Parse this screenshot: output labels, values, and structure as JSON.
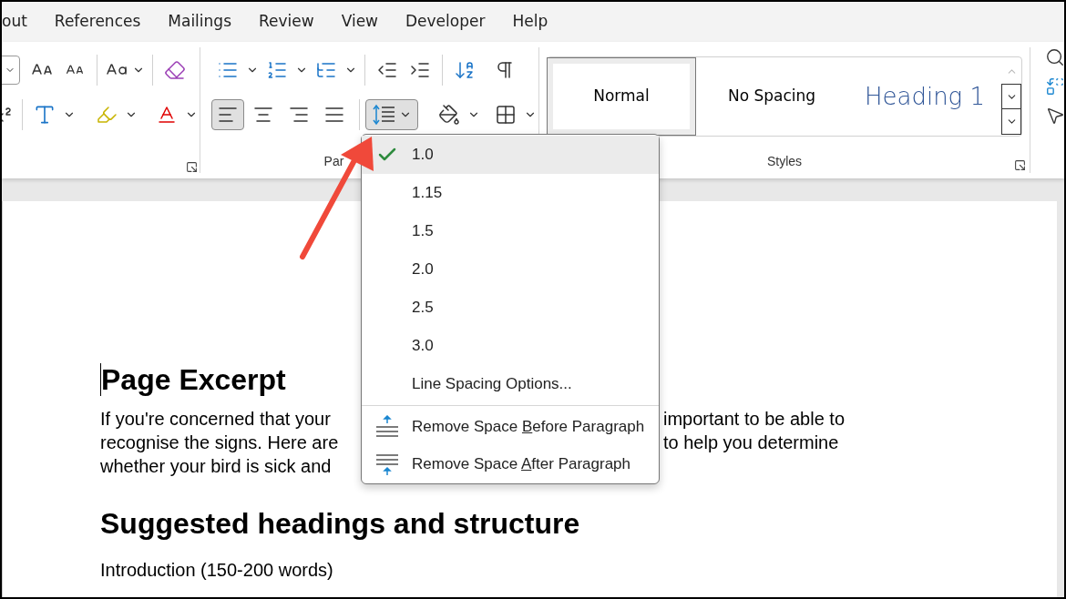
{
  "tabs": [
    {
      "label": "out",
      "selected": false
    },
    {
      "label": "References",
      "selected": false
    },
    {
      "label": "Mailings",
      "selected": false
    },
    {
      "label": "Review",
      "selected": false
    },
    {
      "label": "View",
      "selected": false
    },
    {
      "label": "Developer",
      "selected": false
    },
    {
      "label": "Help",
      "selected": false
    }
  ],
  "paragraph_group": {
    "label": "Par",
    "alignments": [
      {
        "kind": "left",
        "selected": true
      },
      {
        "kind": "center",
        "selected": false
      },
      {
        "kind": "right",
        "selected": false
      },
      {
        "kind": "justify",
        "selected": false
      }
    ],
    "line_spacing_expanded": true
  },
  "styles_group": {
    "label": "Styles",
    "styles": [
      {
        "label": "Normal",
        "kind": "normal",
        "selected": true
      },
      {
        "label": "No Spacing",
        "kind": "normal",
        "selected": false
      },
      {
        "label": "Heading 1",
        "kind": "heading",
        "selected": false
      }
    ]
  },
  "menu": {
    "items": [
      {
        "kind": "value",
        "label": "1.0",
        "checked": true
      },
      {
        "kind": "value",
        "label": "1.15",
        "checked": false
      },
      {
        "kind": "value",
        "label": "1.5",
        "checked": false
      },
      {
        "kind": "value",
        "label": "2.0",
        "checked": false
      },
      {
        "kind": "value",
        "label": "2.5",
        "checked": false
      },
      {
        "kind": "value",
        "label": "3.0",
        "checked": false
      },
      {
        "kind": "option",
        "label": "Line Spacing Options..."
      },
      {
        "kind": "remove_before",
        "before": "Remove Space ",
        "key": "B",
        "after": "efore Paragraph"
      },
      {
        "kind": "remove_after",
        "before": "Remove Space ",
        "key": "A",
        "after": "fter Paragraph"
      }
    ]
  },
  "document": {
    "heading": "Page Excerpt",
    "paragraph_lines": [
      {
        "left": "If you're concerned that your",
        "right": "important to be able to"
      },
      {
        "left": "recognise the signs. Here are",
        "right": "to help you determine"
      },
      {
        "left": "whether your bird is sick and"
      }
    ],
    "subheading": "Suggested headings and structure",
    "body": "Introduction (150-200 words)"
  }
}
